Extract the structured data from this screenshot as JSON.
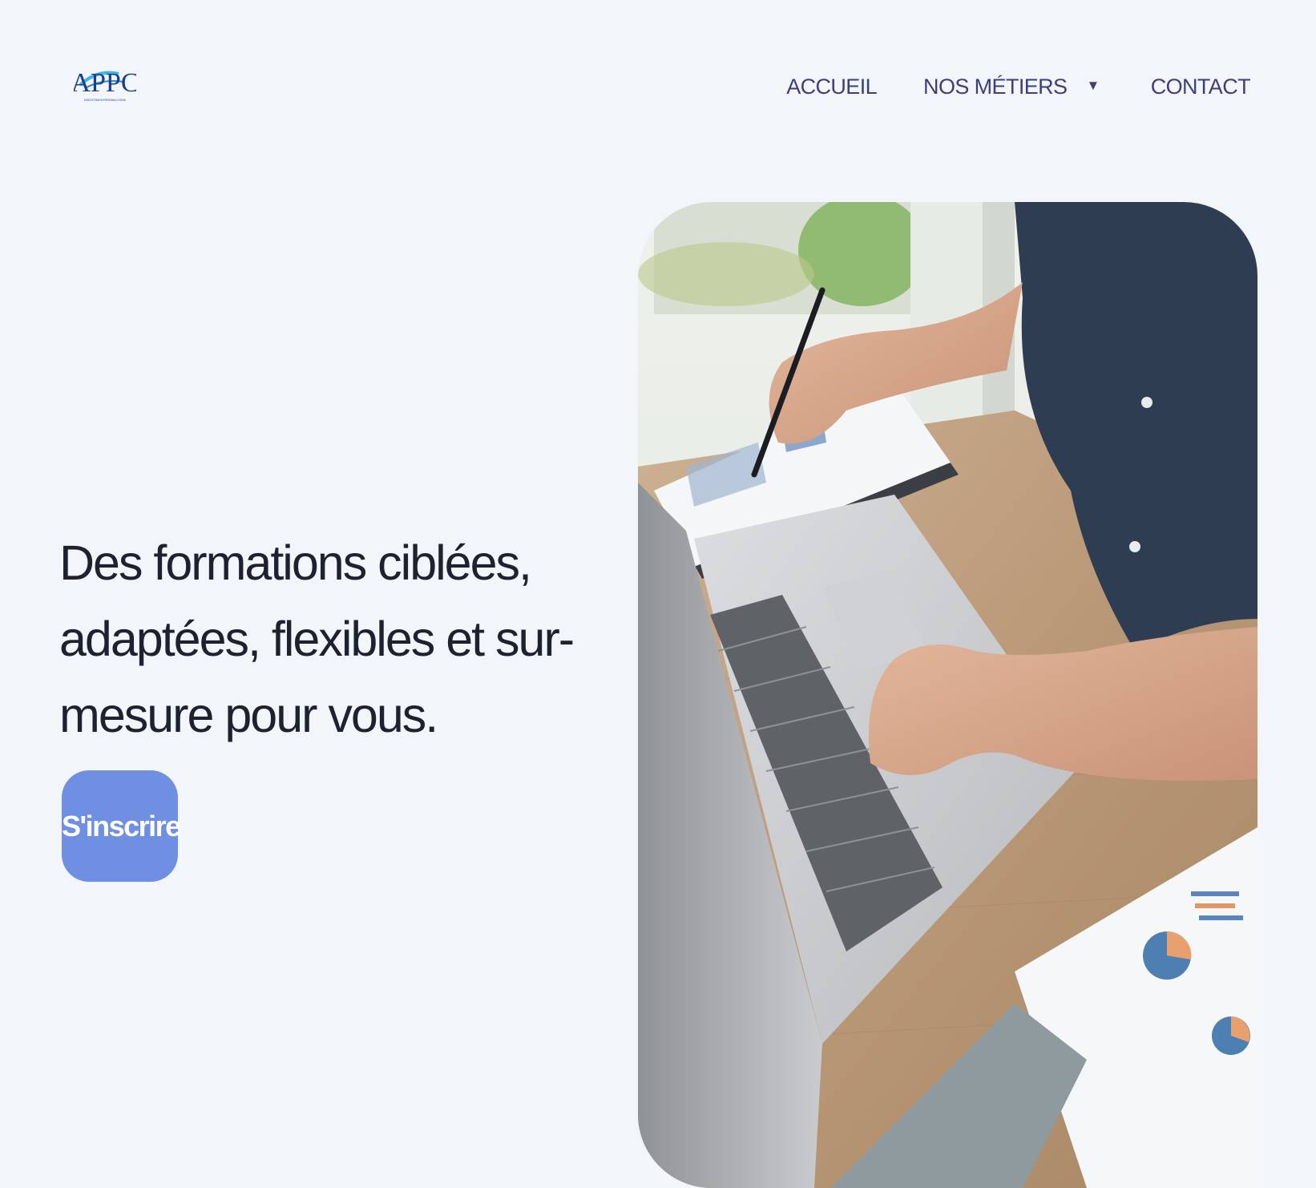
{
  "brand": {
    "logo_text": "APPC",
    "logo_subtext": "AGENCE DE FORMATION PROFESSIONNELLE CONTINUE",
    "logo_icon": "appc-logo-icon"
  },
  "nav": {
    "items": [
      {
        "label": "ACCUEIL"
      },
      {
        "label": "NOS MÉTIERS",
        "has_dropdown": true,
        "dropdown_icon": "caret-down-icon"
      },
      {
        "label": "CONTACT"
      }
    ]
  },
  "hero": {
    "headline": "Des formations ciblées, adaptées, flexibles et sur-mesure pour vous.",
    "cta_label": "S'inscrire",
    "image_icon": "laptop-desk-photo"
  },
  "colors": {
    "background": "#f2f5f9",
    "nav_text": "#3d3f7a",
    "headline_text": "#1c2230",
    "cta_background": "#6f8fe3",
    "cta_text": "#ffffff"
  }
}
